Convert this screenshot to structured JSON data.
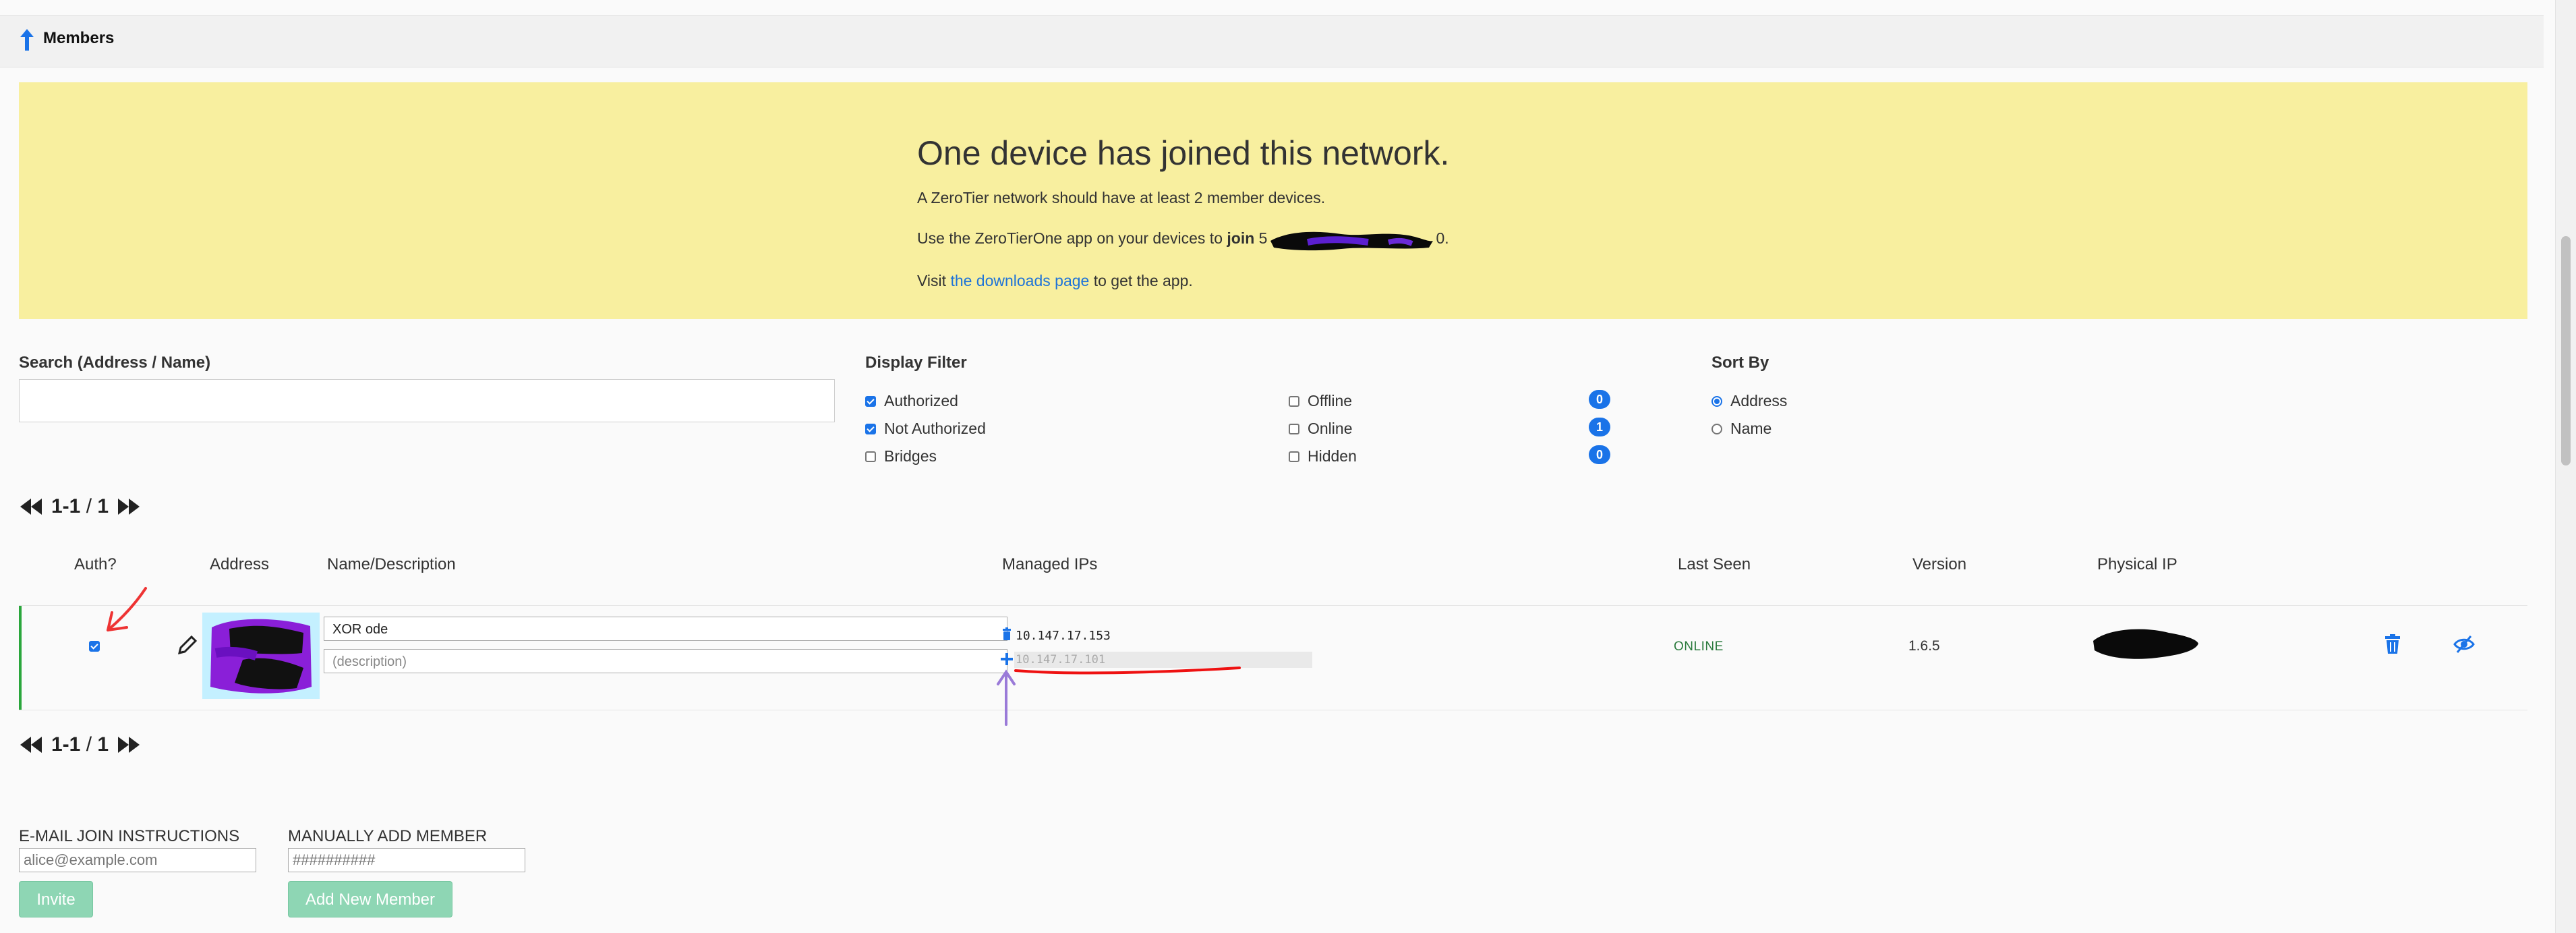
{
  "header": {
    "title": "Members"
  },
  "banner": {
    "headline": "One device has joined this network.",
    "line1": "A ZeroTier network should have at least 2 member devices.",
    "line2_prefix": "Use the ZeroTierOne app on your devices to ",
    "line2_bold": "join",
    "line2_partial": "5",
    "line2_suffix": "0.",
    "line3_prefix": "Visit ",
    "line3_link": "the downloads page",
    "line3_suffix": " to get the app."
  },
  "search": {
    "label": "Search (Address / Name)",
    "value": ""
  },
  "display_filter": {
    "label": "Display Filter",
    "left": [
      {
        "label": "Authorized",
        "checked": true
      },
      {
        "label": "Not Authorized",
        "checked": true
      },
      {
        "label": "Bridges",
        "checked": false
      }
    ],
    "right": [
      {
        "label": "Offline",
        "checked": false,
        "count": "0"
      },
      {
        "label": "Online",
        "checked": false,
        "count": "1"
      },
      {
        "label": "Hidden",
        "checked": false,
        "count": "0"
      }
    ]
  },
  "sort_by": {
    "label": "Sort By",
    "options": [
      {
        "label": "Address",
        "selected": true
      },
      {
        "label": "Name",
        "selected": false
      }
    ]
  },
  "pager": {
    "range": "1-1",
    "separator": "/",
    "total": "1"
  },
  "table": {
    "headers": [
      "Auth?",
      "Address",
      "Name/Description",
      "Managed IPs",
      "Last Seen",
      "Version",
      "Physical IP"
    ],
    "rows": [
      {
        "authorized": true,
        "name": "XOR ode",
        "description_placeholder": "(description)",
        "managed_ip": "10.147.17.153",
        "new_ip_placeholder": "10.147.17.101",
        "last_seen": "ONLINE",
        "version": "1.6.5"
      }
    ]
  },
  "email_join": {
    "label": "E-MAIL JOIN INSTRUCTIONS",
    "placeholder": "alice@example.com",
    "button": "Invite"
  },
  "manual_add": {
    "label": "MANUALLY ADD MEMBER",
    "placeholder": "##########",
    "button": "Add New Member"
  },
  "colors": {
    "accent": "#1a73e8",
    "banner": "#f8ef9f",
    "online": "#2a7a3c",
    "button": "#8ed6b4"
  }
}
